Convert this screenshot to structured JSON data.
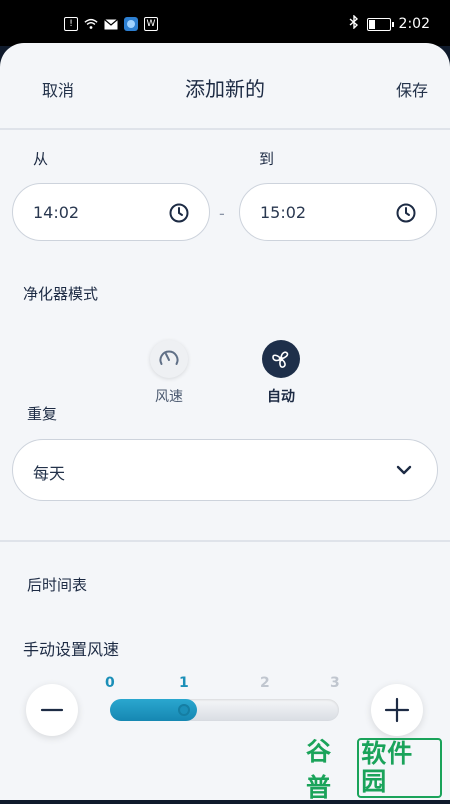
{
  "status_bar": {
    "time": "2:02"
  },
  "header": {
    "cancel": "取消",
    "title": "添加新的",
    "save": "保存"
  },
  "schedule": {
    "from_label": "从",
    "to_label": "到",
    "from_time": "14:02",
    "to_time": "15:02",
    "separator": "-"
  },
  "purifier_mode": {
    "label": "净化器模式",
    "options": [
      {
        "label": "风速",
        "icon": "gauge-icon",
        "selected": false
      },
      {
        "label": "自动",
        "icon": "fan-swirl-icon",
        "selected": true
      }
    ]
  },
  "repeat": {
    "label": "重复",
    "value": "每天"
  },
  "after_schedule": {
    "label": "后时间表"
  },
  "fan_speed": {
    "label": "手动设置风速",
    "ticks": [
      "0",
      "1",
      "2",
      "3"
    ],
    "value": 1,
    "max": 3
  },
  "colors": {
    "accent": "#1b8fb8",
    "dark": "#1d2b44",
    "bg": "#f4f6f9"
  },
  "watermark": {
    "text1": "谷普",
    "text2": "软件园"
  }
}
